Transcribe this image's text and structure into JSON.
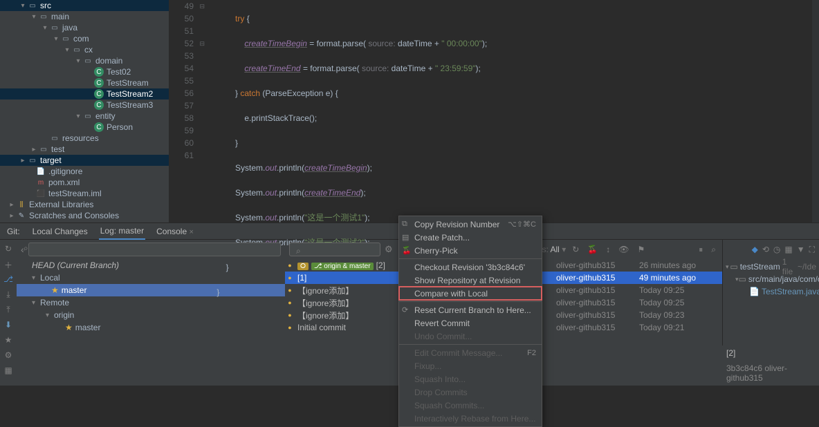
{
  "tree": {
    "src": "src",
    "main": "main",
    "java": "java",
    "com": "com",
    "cx": "cx",
    "domain": "domain",
    "test02": "Test02",
    "teststream": "TestStream",
    "teststream2": "TestStream2",
    "teststream3": "TestStream3",
    "entity": "entity",
    "person": "Person",
    "resources": "resources",
    "test": "test",
    "target": "target",
    "gitignore": ".gitignore",
    "pom": "pom.xml",
    "iml": "testStream.iml",
    "extlib": "External Libraries",
    "scratches": "Scratches and Consoles"
  },
  "gutter": [
    "49",
    "50",
    "51",
    "52",
    "53",
    "54",
    "55",
    "56",
    "57",
    "58",
    "59",
    "60",
    "61"
  ],
  "code": {
    "l49a": "try",
    "l49b": " {",
    "l50a": "createTimeBegin",
    "l50b": " = format.parse(",
    "l50c": " source: ",
    "l50d": "dateTime + ",
    "l50e": "\" 00:00:00\"",
    "l50f": ");",
    "l51a": "createTimeEnd",
    "l51b": " = format.parse(",
    "l51c": " source: ",
    "l51d": "dateTime + ",
    "l51e": "\" 23:59:59\"",
    "l51f": ");",
    "l52a": "} ",
    "l52b": "catch",
    "l52c": " (ParseException e) {",
    "l53": "e.printStackTrace();",
    "l54": "}",
    "l55a": "System.",
    "l55b": "out",
    "l55c": ".println(",
    "l55d": "createTimeBegin",
    "l55e": ");",
    "l56a": "System.",
    "l56b": "out",
    "l56c": ".println(",
    "l56d": "createTimeEnd",
    "l56e": ");",
    "l57a": "System.",
    "l57b": "out",
    "l57c": ".println(",
    "l57d": "\"这是一个测试1\"",
    "l57e": ");",
    "l58a": "System.",
    "l58b": "out",
    "l58c": ".println(",
    "l58d": "\"这是一个测试2\"",
    "l58e": ");",
    "l59": "}",
    "l60": "}"
  },
  "tabs": {
    "git": "Git:",
    "local": "Local Changes",
    "log": "Log: master",
    "console": "Console"
  },
  "branches": {
    "head": "HEAD (Current Branch)",
    "local": "Local",
    "master1": "master",
    "remote": "Remote",
    "origin": "origin",
    "master2": "master"
  },
  "filter": {
    "paths_label": "Paths:",
    "paths_value": "All"
  },
  "commits": [
    {
      "msg": "[2]",
      "tags": [
        "origin & master"
      ],
      "tagColor": "green",
      "author": "oliver-github315",
      "date": "26 minutes ago"
    },
    {
      "msg": "[1]",
      "author": "oliver-github315",
      "date": "49 minutes ago"
    },
    {
      "msg": "【ignore添加】",
      "author": "oliver-github315",
      "date": "Today 09:25"
    },
    {
      "msg": "【ignore添加】",
      "author": "oliver-github315",
      "date": "Today 09:25"
    },
    {
      "msg": "【ignore添加】",
      "author": "oliver-github315",
      "date": "Today 09:23"
    },
    {
      "msg": "Initial commit",
      "author": "oliver-github315",
      "date": "Today 09:21"
    }
  ],
  "menu": {
    "copy_rev": "Copy Revision Number",
    "copy_sc": "⌥⇧⌘C",
    "create_patch": "Create Patch...",
    "cherry": "Cherry-Pick",
    "checkout": "Checkout Revision '3b3c84c6'",
    "show_repo": "Show Repository at Revision",
    "compare": "Compare with Local",
    "reset": "Reset Current Branch to Here...",
    "revert": "Revert Commit",
    "undo": "Undo Commit...",
    "edit_msg": "Edit Commit Message...",
    "edit_sc": "F2",
    "fixup": "Fixup...",
    "squash_into": "Squash Into...",
    "drop": "Drop Commits",
    "squash": "Squash Commits...",
    "rebase": "Interactively Rebase from Here..."
  },
  "right_panel": {
    "root": "testStream",
    "count": "1 file",
    "path_hint": "~/Ide",
    "pkg": "src/main/java/com/c",
    "file": "TestStream.java"
  },
  "detail": {
    "hash_line": "3b3c84c6 oliver-github315",
    "title": "[2]"
  }
}
